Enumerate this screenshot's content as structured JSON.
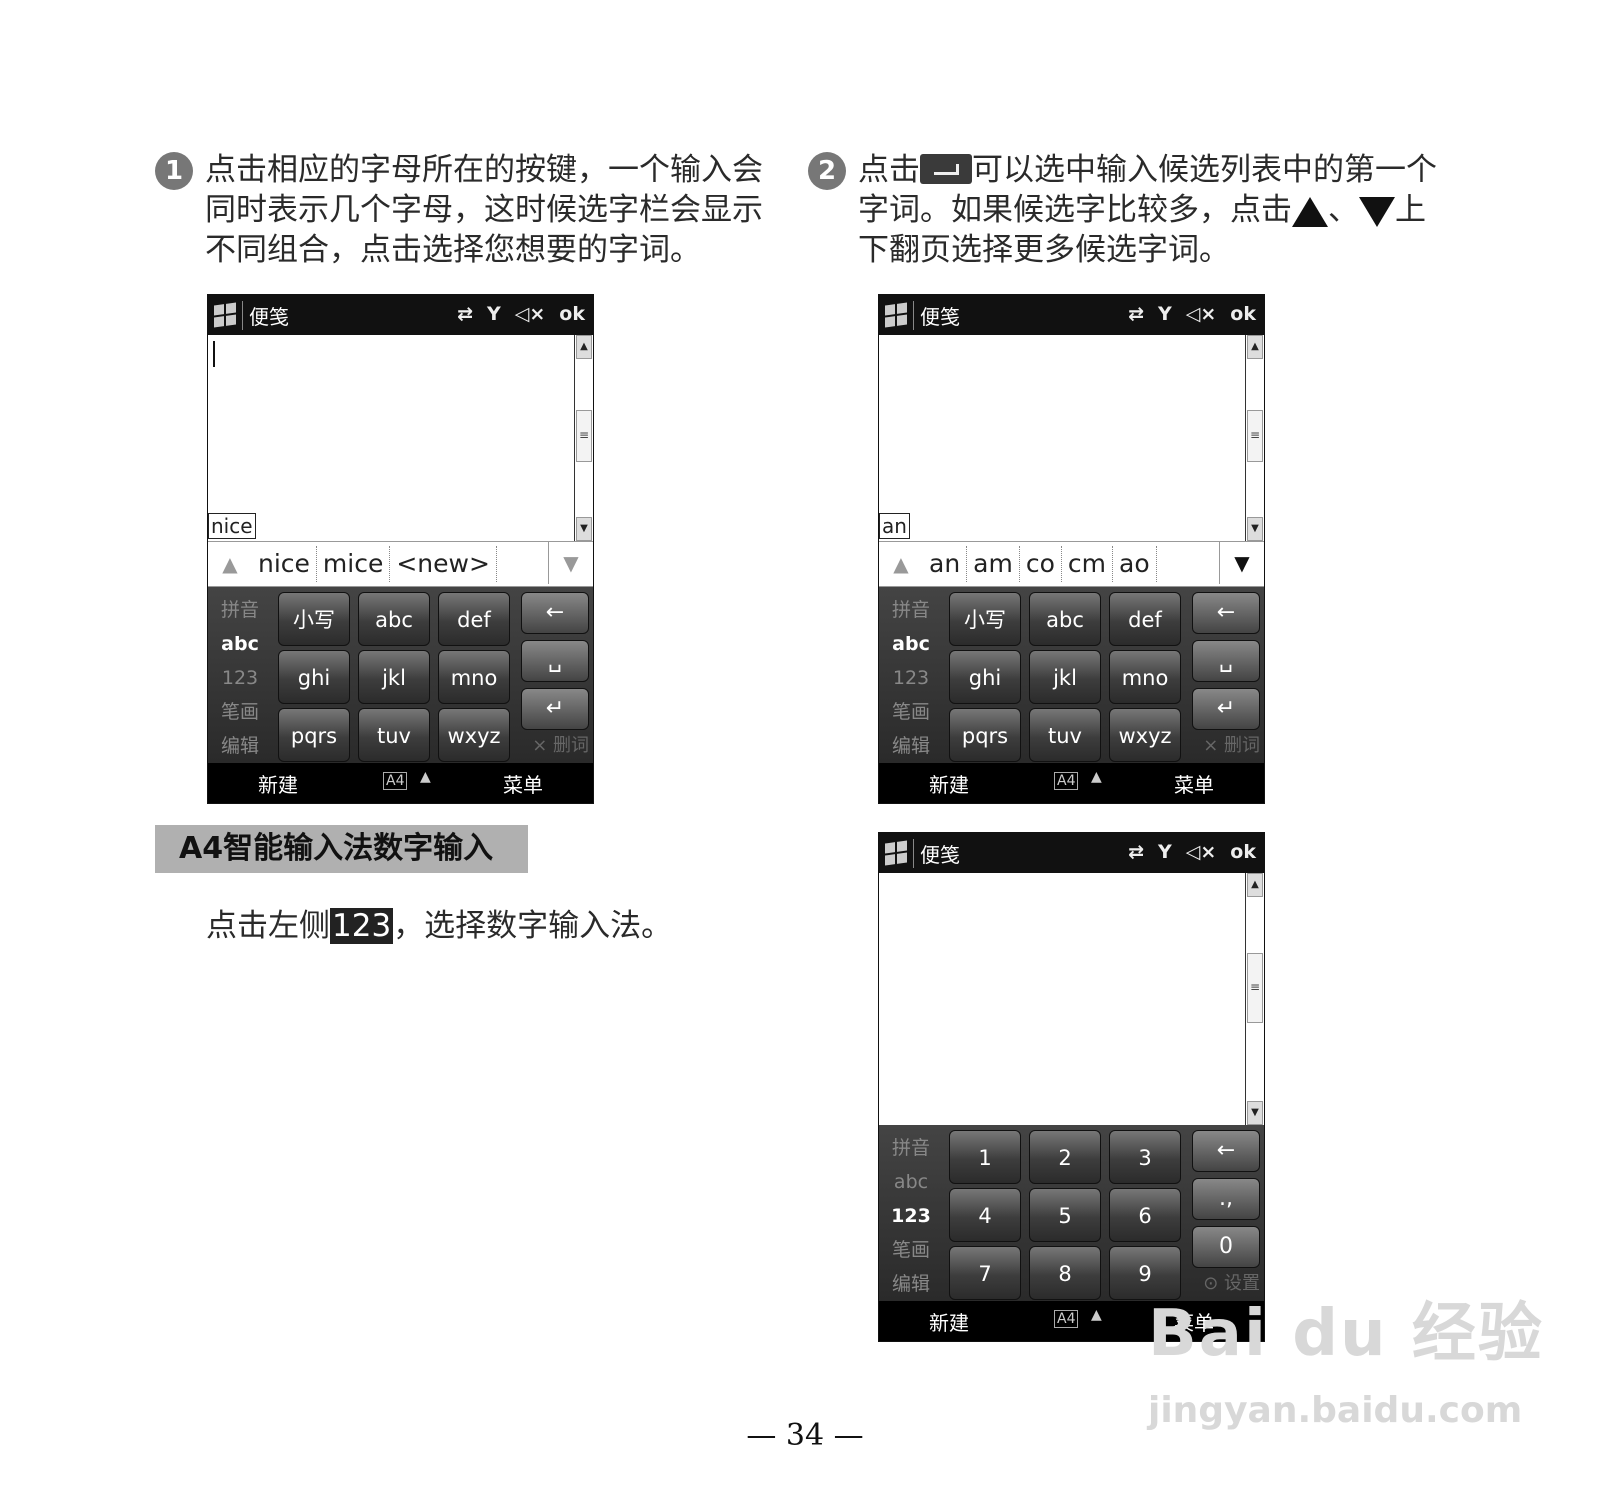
{
  "step1": {
    "number": "1",
    "text": "点击相应的字母所在的按键，一个输入会同时表示几个字母，这时候选字栏会显示不同组合，点击选择您想要的字词。"
  },
  "step2": {
    "number": "2",
    "text_a": "点击",
    "text_b": "可以选中输入候选列表中的第一个字词。如果候选字比较多，点击",
    "text_c": "、",
    "text_d": "上下翻页选择更多候选字词。"
  },
  "phone": {
    "app_title": "便笺",
    "status_ok": "ok",
    "modes": [
      "拼音",
      "abc",
      "123",
      "笔画",
      "编辑"
    ],
    "soft_left": "新建",
    "soft_right": "菜单",
    "ime_badge": "A4",
    "delete_word": "× 删词",
    "settings": "⊙ 设置"
  },
  "screen1": {
    "input": "nice",
    "candidates": [
      "nice",
      "mice",
      "<new>"
    ]
  },
  "screen2": {
    "input": "an",
    "candidates": [
      "an",
      "am",
      "co",
      "cm",
      "ao"
    ]
  },
  "letter_keys": [
    "小写",
    "abc",
    "def",
    "ghi",
    "jkl",
    "mno",
    "pqrs",
    "tuv",
    "wxyz"
  ],
  "number_keys": [
    "1",
    "2",
    "3",
    "4",
    "5",
    "6",
    "7",
    "8",
    "9"
  ],
  "numeric_right_keys": [
    "←",
    ".,",
    "0"
  ],
  "section": {
    "heading": "A4智能输入法数字输入",
    "text_a": "点击左侧",
    "highlight": "123",
    "text_b": "，选择数字输入法。"
  },
  "page_number": "— 34 —",
  "watermark": {
    "brand": "Bai du 经验",
    "url": "jingyan.baidu.com"
  }
}
